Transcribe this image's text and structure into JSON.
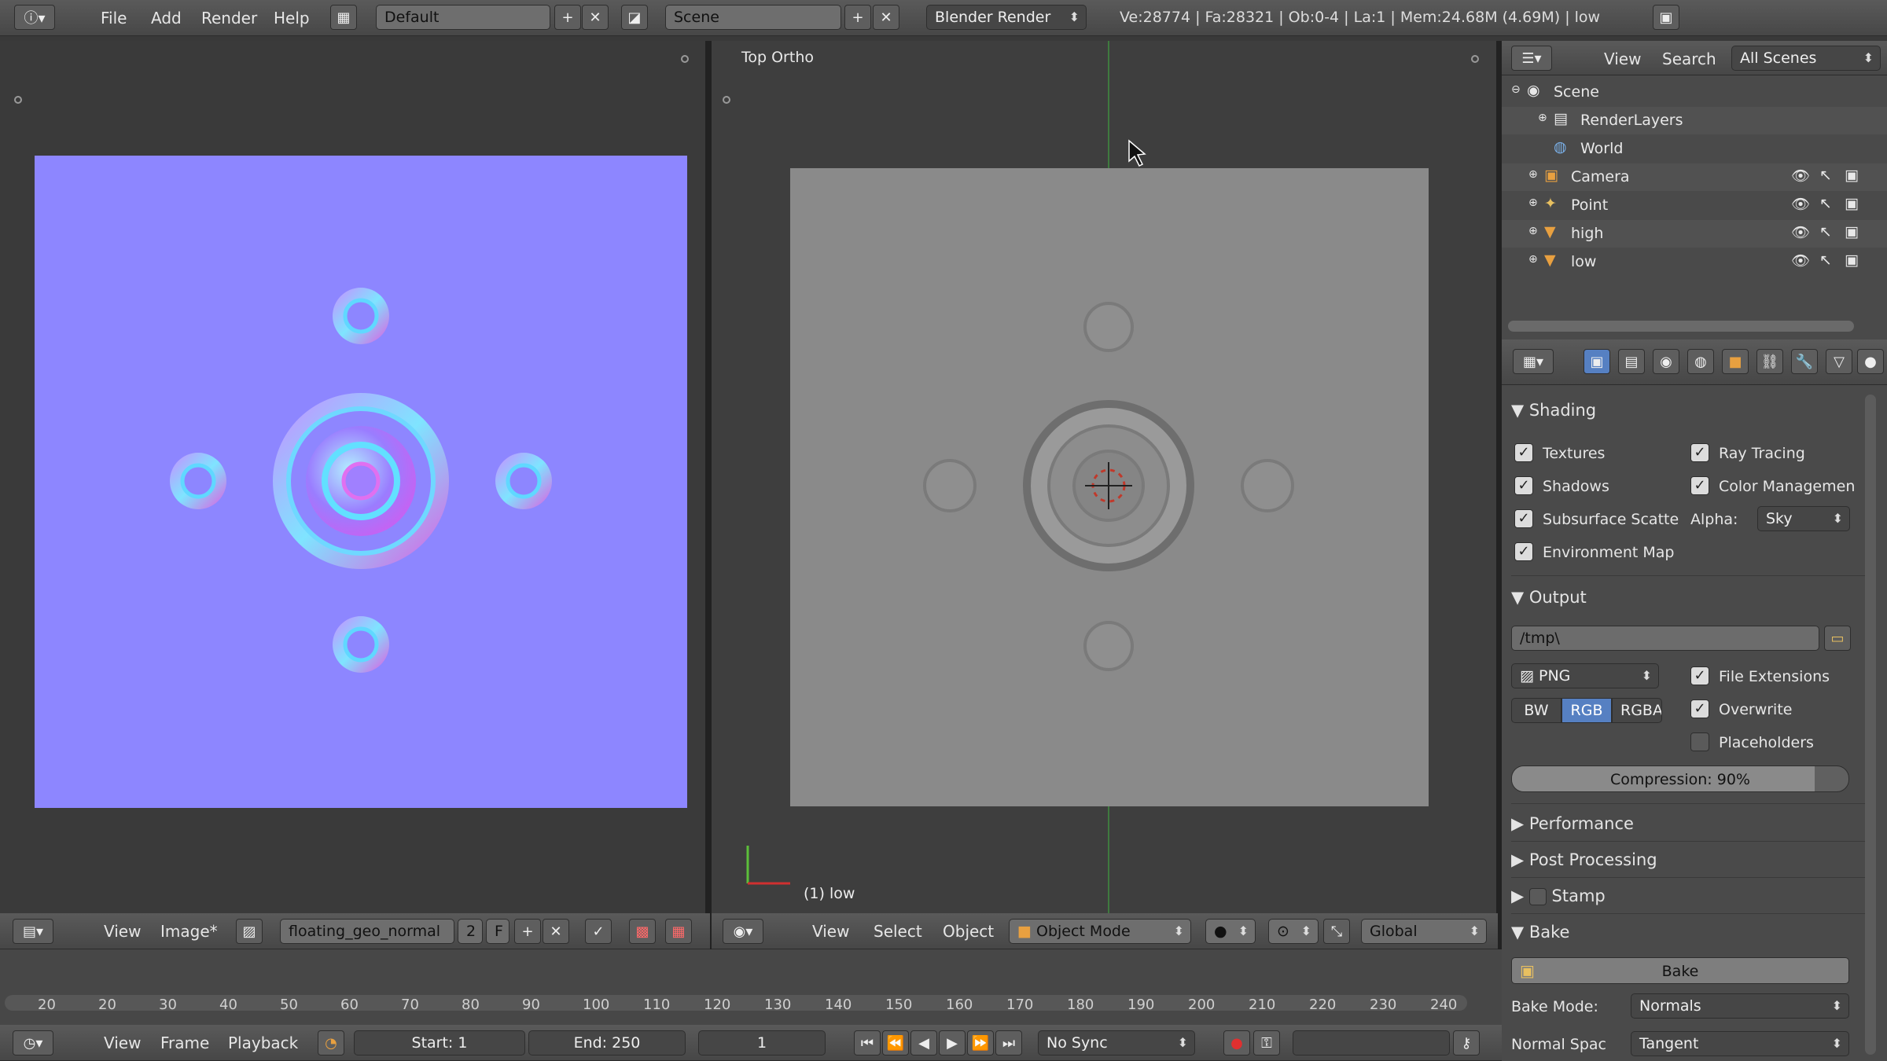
{
  "top_header": {
    "menus": [
      "File",
      "Add",
      "Render",
      "Help"
    ],
    "layout": "Default",
    "scene": "Scene",
    "engine": "Blender Render",
    "stats": "Ve:28774 | Fa:28321 | Ob:0-4 | La:1 | Mem:24.68M (4.69M) | low"
  },
  "uv_editor": {
    "menus": [
      "View",
      "Image*"
    ],
    "image_name": "floating_geo_normal",
    "users": "2",
    "fake_user": "F"
  },
  "viewport": {
    "label": "Top Ortho",
    "object_label": "(1) low",
    "menus": [
      "View",
      "Select",
      "Object"
    ],
    "mode": "Object Mode",
    "orientation": "Global"
  },
  "outliner": {
    "menus": [
      "View",
      "Search"
    ],
    "filter": "All Scenes",
    "items": [
      {
        "label": "Scene",
        "icon": "scene-icon"
      },
      {
        "label": "RenderLayers",
        "icon": "render-layers-icon"
      },
      {
        "label": "World",
        "icon": "world-icon"
      },
      {
        "label": "Camera",
        "icon": "camera-icon"
      },
      {
        "label": "Point",
        "icon": "lamp-icon"
      },
      {
        "label": "high",
        "icon": "mesh-icon"
      },
      {
        "label": "low",
        "icon": "mesh-icon"
      }
    ]
  },
  "properties": {
    "shading": {
      "title": "Shading",
      "textures": "Textures",
      "shadows": "Shadows",
      "sss": "Subsurface Scatte",
      "envmap": "Environment Map",
      "raytracing": "Ray Tracing",
      "color_mgmt": "Color Managemen",
      "alpha_label": "Alpha:",
      "alpha_value": "Sky"
    },
    "output": {
      "title": "Output",
      "path": "/tmp\\",
      "format": "PNG",
      "bw": "BW",
      "rgb": "RGB",
      "rgba": "RGBA",
      "file_ext": "File Extensions",
      "overwrite": "Overwrite",
      "placeholders": "Placeholders",
      "compression": "Compression: 90%",
      "compression_value": 0.9
    },
    "collapsed": [
      "Performance",
      "Post Processing",
      "Stamp"
    ],
    "bake": {
      "title": "Bake",
      "button": "Bake",
      "mode_label": "Bake Mode:",
      "mode_value": "Normals",
      "space_label": "Normal Spac",
      "space_value": "Tangent"
    }
  },
  "timeline": {
    "ticks": [
      "20",
      "20",
      "30",
      "40",
      "50",
      "60",
      "70",
      "80",
      "90",
      "100",
      "110",
      "120",
      "130",
      "140",
      "150",
      "160",
      "170",
      "180",
      "190",
      "200",
      "210",
      "220",
      "230",
      "240"
    ],
    "menus": [
      "View",
      "Frame",
      "Playback"
    ],
    "start": "Start: 1",
    "end": "End: 250",
    "current": "1",
    "sync": "No Sync"
  },
  "colors": {
    "normal_map": "#8d86ff",
    "bake_plane": "#8a8a8a",
    "selected_blue": "#5680c2"
  }
}
